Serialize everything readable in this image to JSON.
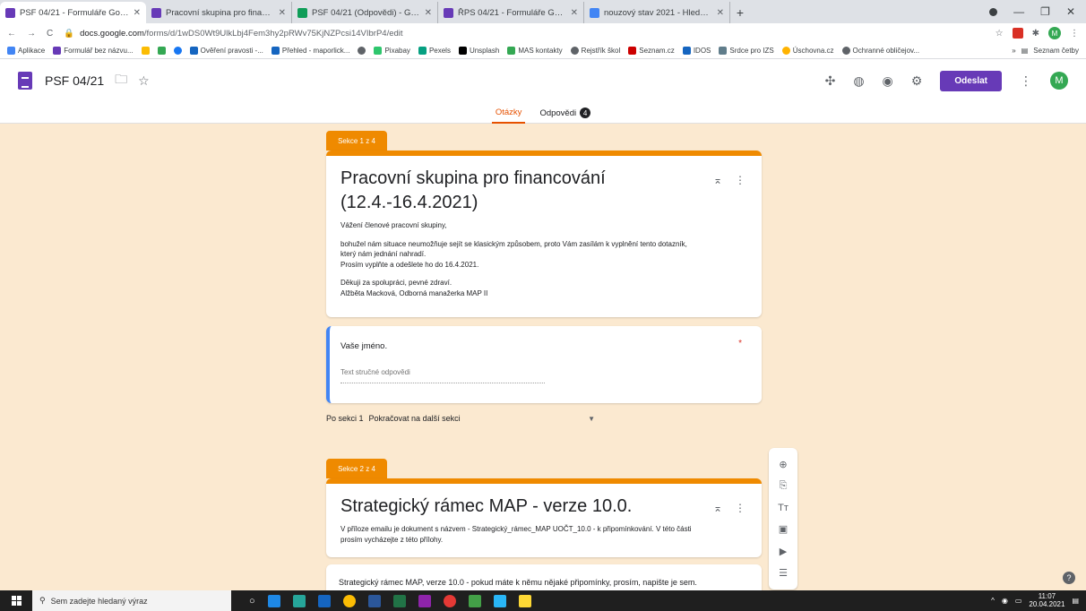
{
  "browser": {
    "tabs": [
      {
        "label": "PSF 04/21 - Formuláře Google",
        "color": "#673ab7",
        "active": true
      },
      {
        "label": "Pracovní skupina pro financování",
        "color": "#673ab7",
        "active": false
      },
      {
        "label": "PSF 04/21 (Odpovědi) - Google S",
        "color": "#0f9d58",
        "active": false
      },
      {
        "label": "ŘPS 04/21 - Formuláře Google",
        "color": "#673ab7",
        "active": false
      },
      {
        "label": "nouzový stav 2021 - Hledat Goo",
        "color": "#4285f4",
        "active": false
      }
    ],
    "new_tab": "+",
    "url_host": "docs.google.com",
    "url_path": "/forms/d/1wDS0Wt9UlkLbj4Fem3hy2pRWv75KjNZPcsi14VIbrP4/edit",
    "profile_initial": "M",
    "bookmarks": [
      {
        "label": "Aplikace",
        "color": "#4285f4"
      },
      {
        "label": "Formulář bez názvu...",
        "color": "#673ab7"
      },
      {
        "label": "",
        "color": "#fbbc04"
      },
      {
        "label": "",
        "color": "#34a853"
      },
      {
        "label": "",
        "color": "#1877f2"
      },
      {
        "label": "Ověření pravosti -...",
        "color": "#1565c0"
      },
      {
        "label": "Přehled - maporlick...",
        "color": "#1565c0"
      },
      {
        "label": "",
        "color": "#5f6368"
      },
      {
        "label": "Pixabay",
        "color": "#2ec66d"
      },
      {
        "label": "Pexels",
        "color": "#05a081"
      },
      {
        "label": "Unsplash",
        "color": "#000000"
      },
      {
        "label": "MAS kontakty",
        "color": "#34a853"
      },
      {
        "label": "Rejstřík škol",
        "color": "#5f6368"
      },
      {
        "label": "Seznam.cz",
        "color": "#cc0000"
      },
      {
        "label": "IDOS",
        "color": "#1565c0"
      },
      {
        "label": "Srdce pro IZS",
        "color": "#607d8b"
      },
      {
        "label": "Úschovna.cz",
        "color": "#ffb300"
      },
      {
        "label": "Ochranné obličejov...",
        "color": "#5f6368"
      }
    ],
    "bookmarks_more": "»",
    "reading_list": "Seznam četby"
  },
  "form": {
    "title": "PSF 04/21",
    "send_label": "Odeslat",
    "avatar_initial": "M",
    "tab_questions": "Otázky",
    "tab_responses": "Odpovědi",
    "responses_count": "4"
  },
  "section1": {
    "label": "Sekce 1 z 4",
    "title_line1": "Pracovní skupina pro financování",
    "title_line2": "(12.4.-16.4.2021)",
    "greeting": "Vážení členové pracovní skupiny,",
    "p1_line1": "bohužel nám situace neumožňuje sejít se klasickým způsobem, proto Vám zasílám k vyplnění tento dotazník,",
    "p1_line2": "který nám jednání nahradí.",
    "p1_line3": "Prosím vyplňte a odešlete ho do 16.4.2021.",
    "thanks": "Děkuji za spolupráci, pevné zdraví.",
    "signature": "Alžběta Macková, Odborná manažerka MAP II"
  },
  "question1": {
    "title": "Vaše jméno.",
    "required_mark": "*",
    "placeholder": "Text stručné odpovědi"
  },
  "after_section": {
    "label": "Po sekci 1",
    "value": "Pokračovat na další sekci"
  },
  "section2": {
    "label": "Sekce 2 z 4",
    "title": "Strategický rámec MAP  - verze 10.0.",
    "desc_line1": "V příloze emailu je dokument s názvem - Strategický_rámec_MAP UOČT_10.0 - k připomínkování.  V této části",
    "desc_line2": "prosím vycházejte z této přílohy."
  },
  "question2": {
    "title": "Strategický rámec MAP, verze 10.0 - pokud máte k němu nějaké připomínky, prosím, napište je sem."
  },
  "taskbar": {
    "search_placeholder": "Sem zadejte hledaný výraz",
    "time": "11:07",
    "date": "20.04.2021",
    "apps": [
      "#ffffff",
      "#1e88e5",
      "#26a69a",
      "#1565c0",
      "#fbbc04",
      "#2b579a",
      "#217346",
      "#8e24aa",
      "#e53935",
      "#43a047",
      "#29b6f6",
      "#fdd835"
    ]
  }
}
